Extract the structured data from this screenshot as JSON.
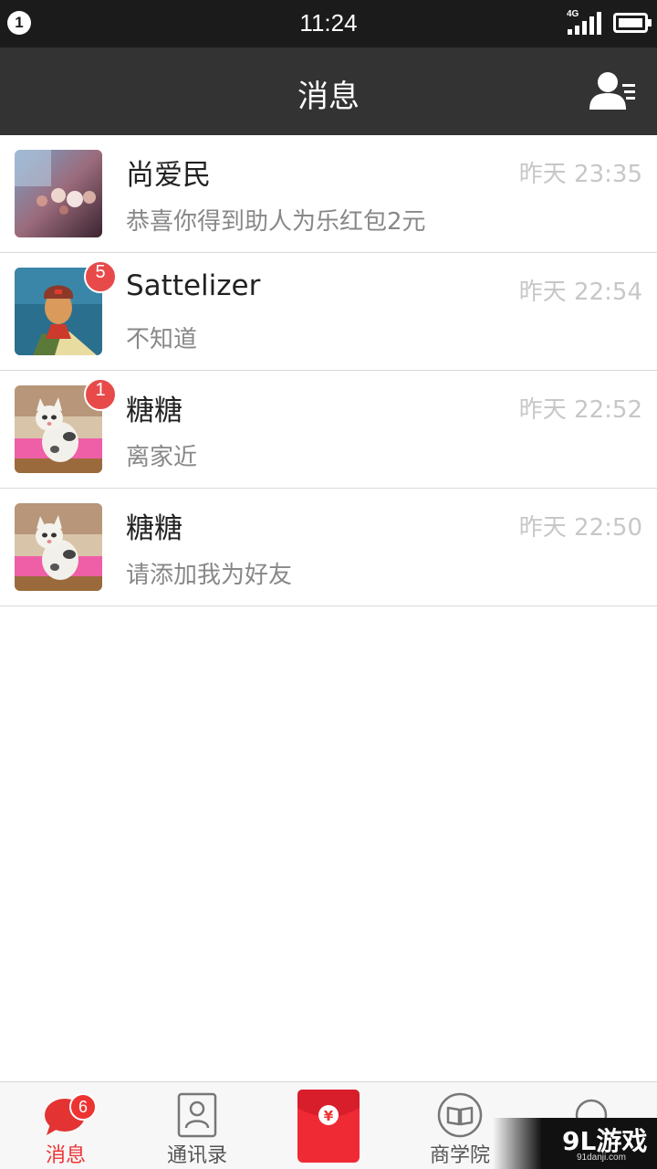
{
  "status_bar": {
    "notification_count": "1",
    "time": "11:24",
    "network": "4G"
  },
  "nav": {
    "title": "消息",
    "contacts_icon": "contacts-icon"
  },
  "messages": [
    {
      "name": "尚爱民",
      "preview": "恭喜你得到助人为乐红包2元",
      "time": "昨天 23:35",
      "badge": "",
      "avatar": "bokeh-photo"
    },
    {
      "name": "Sattelizer",
      "preview": "不知道",
      "time": "昨天 22:54",
      "badge": "5",
      "avatar": "portrait-painting"
    },
    {
      "name": "糖糖",
      "preview": "离家近",
      "time": "昨天 22:52",
      "badge": "1",
      "avatar": "cat-photo"
    },
    {
      "name": "糖糖",
      "preview": "请添加我为好友",
      "time": "昨天 22:50",
      "badge": "",
      "avatar": "cat-photo"
    }
  ],
  "tabs": [
    {
      "label": "消息",
      "icon": "chat-bubble-icon",
      "badge": "6",
      "active": true
    },
    {
      "label": "通讯录",
      "icon": "contact-book-icon"
    },
    {
      "label": "",
      "icon": "red-packet-icon"
    },
    {
      "label": "商学院",
      "icon": "book-icon"
    },
    {
      "label": "",
      "icon": "profile-icon"
    }
  ],
  "watermark": {
    "logo": "9L游戏",
    "url": "91danji.com"
  },
  "colors": {
    "accent": "#e33333",
    "nav_bg": "#333333",
    "status_bg": "#1b1b1b"
  }
}
